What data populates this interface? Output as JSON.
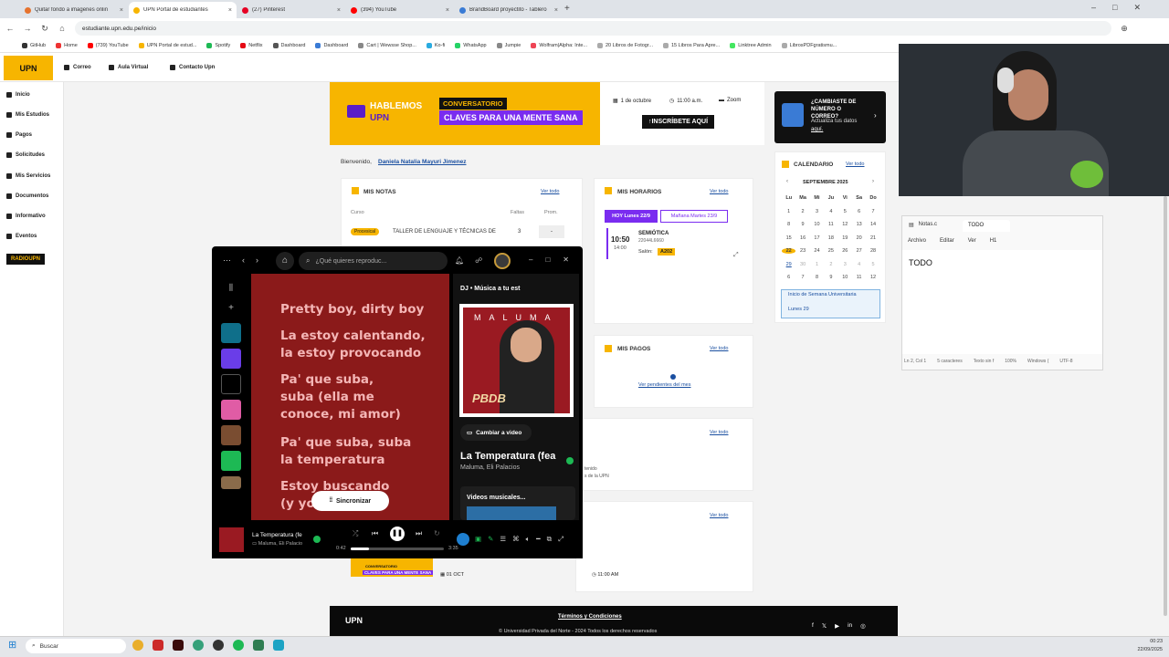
{
  "browser": {
    "tabs": [
      {
        "label": "Quitar fondo a imagenes onlin",
        "fav": "#e6732e",
        "active": false
      },
      {
        "label": "UPN Portal de estudiantes",
        "fav": "#f7b500",
        "active": true
      },
      {
        "label": "(27) Pinterest",
        "fav": "#e60023",
        "active": false
      },
      {
        "label": "(394) YouTube",
        "fav": "#ff0000",
        "active": false
      },
      {
        "label": "BrandBoard proyectito - Tablero",
        "fav": "#3a7bd5",
        "active": false
      }
    ],
    "new_tab": "+",
    "url": "estudiante.upn.edu.pe/inicio",
    "bookmarks": [
      "GitHub",
      "Home",
      "(739) YouTube",
      "UPN Portal de estud...",
      "Spotify",
      "Netflix",
      "Dashboard",
      "Dashboard",
      "Cart | Wewsse Shop...",
      "Ko-fi",
      "WhatsApp",
      "Jumpie",
      "Wolfram|Alpha: Inte...",
      "20 Libros de Fotogr...",
      "15 Libros Para Apre...",
      "Linktree Admin",
      "LibrosPDFgratismu..."
    ]
  },
  "site": {
    "logo": "UPN",
    "header_links": [
      "Correo",
      "Aula Virtual",
      "Contacto Upn"
    ],
    "sidebar": [
      "Inicio",
      "Mis Estudios",
      "Pagos",
      "Solicitudes",
      "Mis Servicios",
      "Documentos",
      "Informativo",
      "Eventos"
    ],
    "radio": "RADIOUPN",
    "banner": {
      "brand": "HABLEMOS",
      "brand2": "UPN",
      "tag": "CONVERSATORIO",
      "headline": "CLAVES PARA UNA MENTE SANA"
    },
    "event": {
      "date": "1 de octubre",
      "time": "11:00 a.m.",
      "mode": "Zoom",
      "cta": "INSCRÍBETE AQUÍ"
    },
    "phone_card": {
      "title": "¿CAMBIASTE DE NÚMERO O CORREO?",
      "body": "Actualiza tus datos",
      "link": "aquí."
    },
    "welcome": "Bienvenido,",
    "student": "Daniela Natalia Mayuri Jimenez",
    "notas": {
      "title": "MIS NOTAS",
      "vertodo": "Ver todo",
      "col_course": "Curso",
      "col_faltas": "Faltas",
      "col_prom": "Prom.",
      "badge": "Procesical",
      "course": "TALLER DE LENGUAJE Y TÉCNICAS DE",
      "faltas": "3",
      "prom": "-"
    },
    "horarios": {
      "title": "MIS HORARIOS",
      "vertodo": "Ver todo",
      "today": "HOY Lunes 22/9",
      "tomorrow": "Mañana Martes 23/9",
      "start": "10:50",
      "end": "14:00",
      "course": "SEMIÓTICA",
      "code": "22044L6660",
      "room_label": "Salón:",
      "room": "A202"
    },
    "pagos": {
      "title": "MIS PAGOS",
      "vertodo": "Ver todo",
      "link": "Ver pendientes del mes"
    },
    "extra1": {
      "vertodo": "Ver todo",
      "line1": "tenido",
      "line2": "s de la UPN"
    },
    "extra2": {
      "vertodo": "Ver todo"
    },
    "calendar": {
      "title": "CALENDARIO",
      "vertodo": "Ver todo",
      "month": "SEPTIEMBRE 2025",
      "days": [
        "Lu",
        "Ma",
        "Mi",
        "Ju",
        "Vi",
        "Sa",
        "Do"
      ],
      "weeks": [
        [
          "1",
          "2",
          "3",
          "4",
          "5",
          "6",
          "7"
        ],
        [
          "8",
          "9",
          "10",
          "11",
          "12",
          "13",
          "14"
        ],
        [
          "15",
          "16",
          "17",
          "18",
          "19",
          "20",
          "21"
        ],
        [
          "22",
          "23",
          "24",
          "25",
          "26",
          "27",
          "28"
        ],
        [
          "29",
          "30",
          "1",
          "2",
          "3",
          "4",
          "5"
        ],
        [
          "6",
          "7",
          "8",
          "9",
          "10",
          "11",
          "12"
        ]
      ],
      "event_title": "Inicio de Semana Universitaria",
      "event_date": "Lunes 29"
    },
    "bottom": {
      "tag": "CONVERSATORIO",
      "headline": "CLAVES PARA UNA MENTE SANA",
      "date": "01 OCT",
      "time": "11:00 AM"
    },
    "footer": {
      "terms": "Términos y Condiciones",
      "copy": "© Universidad Privada del Norte - 2024 Todos los derechos reservados"
    }
  },
  "spotify": {
    "search_placeholder": "¿Qué quieres reproduc...",
    "lyrics": [
      "Pretty boy, dirty boy",
      "La estoy calentando,",
      "la estoy provocando",
      "Pa' que suba,",
      "suba (ella me",
      "conoce, mi amor)",
      "Pa' que suba, suba",
      "la temperatura",
      "Estoy buscando",
      "(y yo"
    ],
    "sync": "Sincronizar",
    "dj": "DJ • Música a tu est",
    "cover_artist": "MALUMA",
    "cover_title": "PBDB",
    "switch_video": "Cambiar a video",
    "track": "La Temperatura (fea",
    "artists": "Maluma, Eli Palacios",
    "videos": "Videos musicales...",
    "bar_track": "La Temperatura (fe",
    "bar_artists": "Maluma, Eli Palacio",
    "elapsed": "0:42",
    "total": "3:35",
    "progress": 0.2
  },
  "notepad": {
    "tab1": "Notas.c",
    "tab2": "TODO",
    "menu": [
      "Archivo",
      "Editar",
      "Ver",
      "H1"
    ],
    "content": "TODO",
    "status": [
      "Ln 2, Col 1",
      "5 caracteres",
      "Texto sin f",
      "100%",
      "Windows (",
      "UTF-8"
    ]
  },
  "taskbar": {
    "search": "Buscar",
    "time": "00:23",
    "date": "22/09/2025"
  }
}
